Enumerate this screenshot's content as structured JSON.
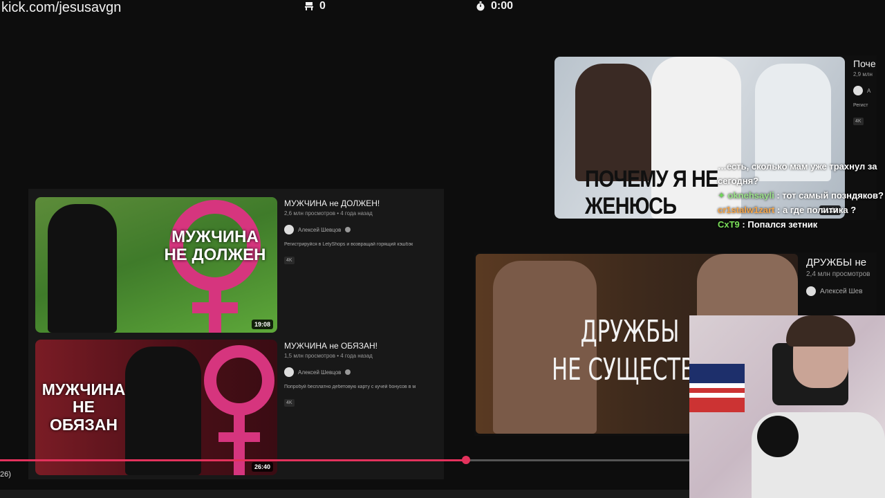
{
  "overlay": {
    "url": "kick.com/jesusavgn",
    "seat_count": "0",
    "timer": "0:00"
  },
  "videos_left": [
    {
      "title": "МУЖЧИНА не ДОЛЖЕН!",
      "stats": "2,6 млн просмотров • 4 года назад",
      "channel": "Алексей Шевцов",
      "description": "Регистрируйся в LetyShops и возвращай горящий кэшбэк",
      "badge": "4K",
      "duration": "19:08",
      "thumb_text": "МУЖЧИНА НЕ ДОЛЖЕН"
    },
    {
      "title": "МУЖЧИНА не ОБЯЗАН!",
      "stats": "1,5 млн просмотров • 4 года назад",
      "channel": "Алексей Шевцов",
      "description": "Попробуй бесплатно дебетовую карту с кучей бонусов в м",
      "badge": "4K",
      "duration": "26:40",
      "thumb_text": "МУЖЧИНА НЕ ОБЯЗАН"
    }
  ],
  "video_right_top": {
    "title": "Поче",
    "stats": "2,9 млн",
    "channel": "А",
    "description": "Регист",
    "badge": "4K",
    "duration": "21:31",
    "thumb_text": "ПОЧЕМУ Я НЕ ЖЕНЮСЬ"
  },
  "video_right_mid": {
    "title": "ДРУЖБЫ не",
    "stats": "2,4 млн просмотров",
    "channel": "Алексей Шев",
    "thumb_text_line1": "ДРУЖБЫ",
    "thumb_text_line2": "НЕ СУЩЕСТВУ"
  },
  "chat": [
    {
      "user": "",
      "text": "…есть, сколько мам уже трахнул за сегодня?",
      "color": "#ffffff"
    },
    {
      "user": "oknehsayli",
      "text": " : тот самый позндяков?",
      "color": "#9be28a"
    },
    {
      "user": "cr1stalw1zart",
      "text": " : а где политика ?",
      "color": "#f3a54a"
    },
    {
      "user": "CxT9",
      "text": " : Попался зетник",
      "color": "#7be05a"
    }
  ],
  "player": {
    "progress_fraction": 0.676,
    "time_partial": "26)"
  },
  "colors": {
    "accent": "#e3325c",
    "panel": "#181818",
    "background": "#0d0d0d"
  }
}
